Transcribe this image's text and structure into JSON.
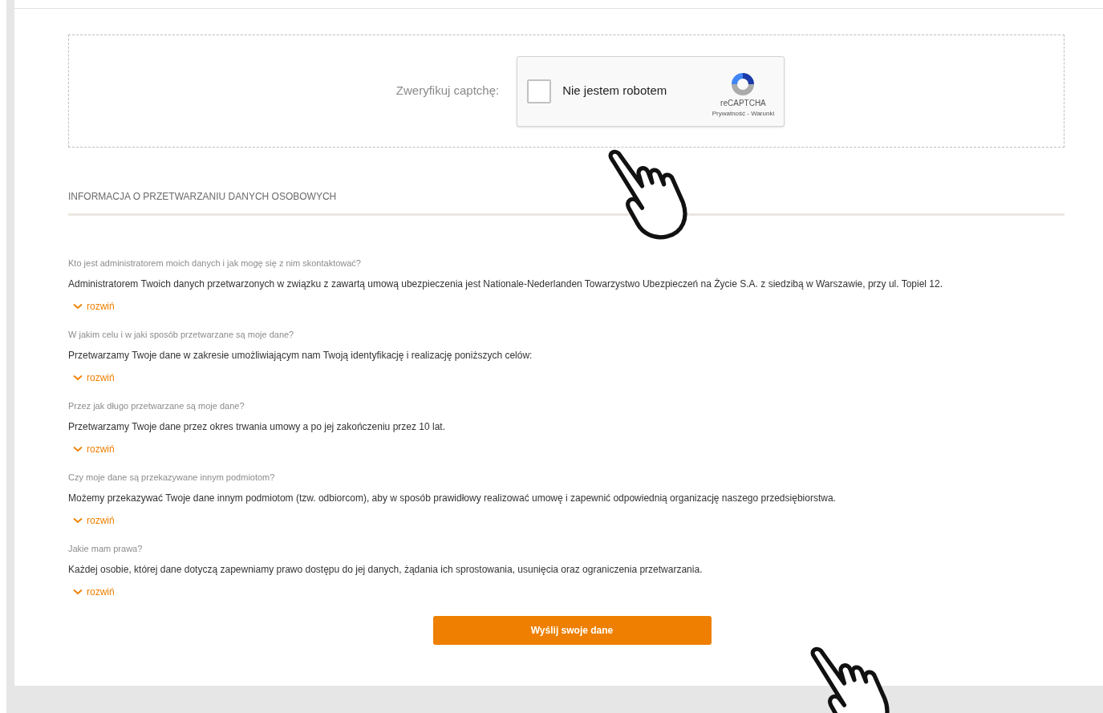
{
  "captcha": {
    "label": "Zweryfikuj captchę:",
    "widget": {
      "checked": false,
      "text": "Nie jestem robotem",
      "brand": "reCAPTCHA",
      "links": "Prywatność - Warunki"
    }
  },
  "section": {
    "title": "INFORMACJA O PRZETWARZANIU DANYCH OSOBOWYCH"
  },
  "faq": [
    {
      "question": "Kto jest administratorem moich danych i jak mogę się z nim skontaktować?",
      "answer": "Administratorem Twoich danych przetwarzonych w związku z zawartą umową ubezpieczenia jest Nationale-Nederlanden Towarzystwo Ubezpieczeń na Życie S.A. z siedzibą w Warszawie, przy ul. Topiel 12.",
      "toggle": "rozwiń",
      "expanded": false
    },
    {
      "question": "W jakim celu i w jaki sposób przetwarzane są moje dane?",
      "answer": "Przetwarzamy Twoje dane w zakresie umożliwiającym nam Twoją identyfikację i realizację poniższych celów:",
      "toggle": "rozwiń",
      "expanded": false
    },
    {
      "question": "Przez jak długo przetwarzane są moje dane?",
      "answer": "Przetwarzamy Twoje dane przez okres trwania umowy a po jej zakończeniu przez 10 lat.",
      "toggle": "rozwiń",
      "expanded": false
    },
    {
      "question": "Czy moje dane są przekazywane innym podmiotom?",
      "answer": "Możemy przekazywać Twoje dane innym podmiotom (tzw. odbiorcom), aby w sposób prawidłowy realizować umowę i zapewnić odpowiednią organizację naszego przedsiębiorstwa.",
      "toggle": "rozwiń",
      "expanded": false
    },
    {
      "question": "Jakie mam prawa?",
      "answer": "Każdej osobie, której dane dotyczą zapewniamy prawo dostępu do jej danych, żądania ich sprostowania, usunięcia oraz ograniczenia przetwarzania.",
      "toggle": "rozwiń",
      "expanded": false
    }
  ],
  "submit": {
    "label": "Wyślij swoje dane"
  }
}
